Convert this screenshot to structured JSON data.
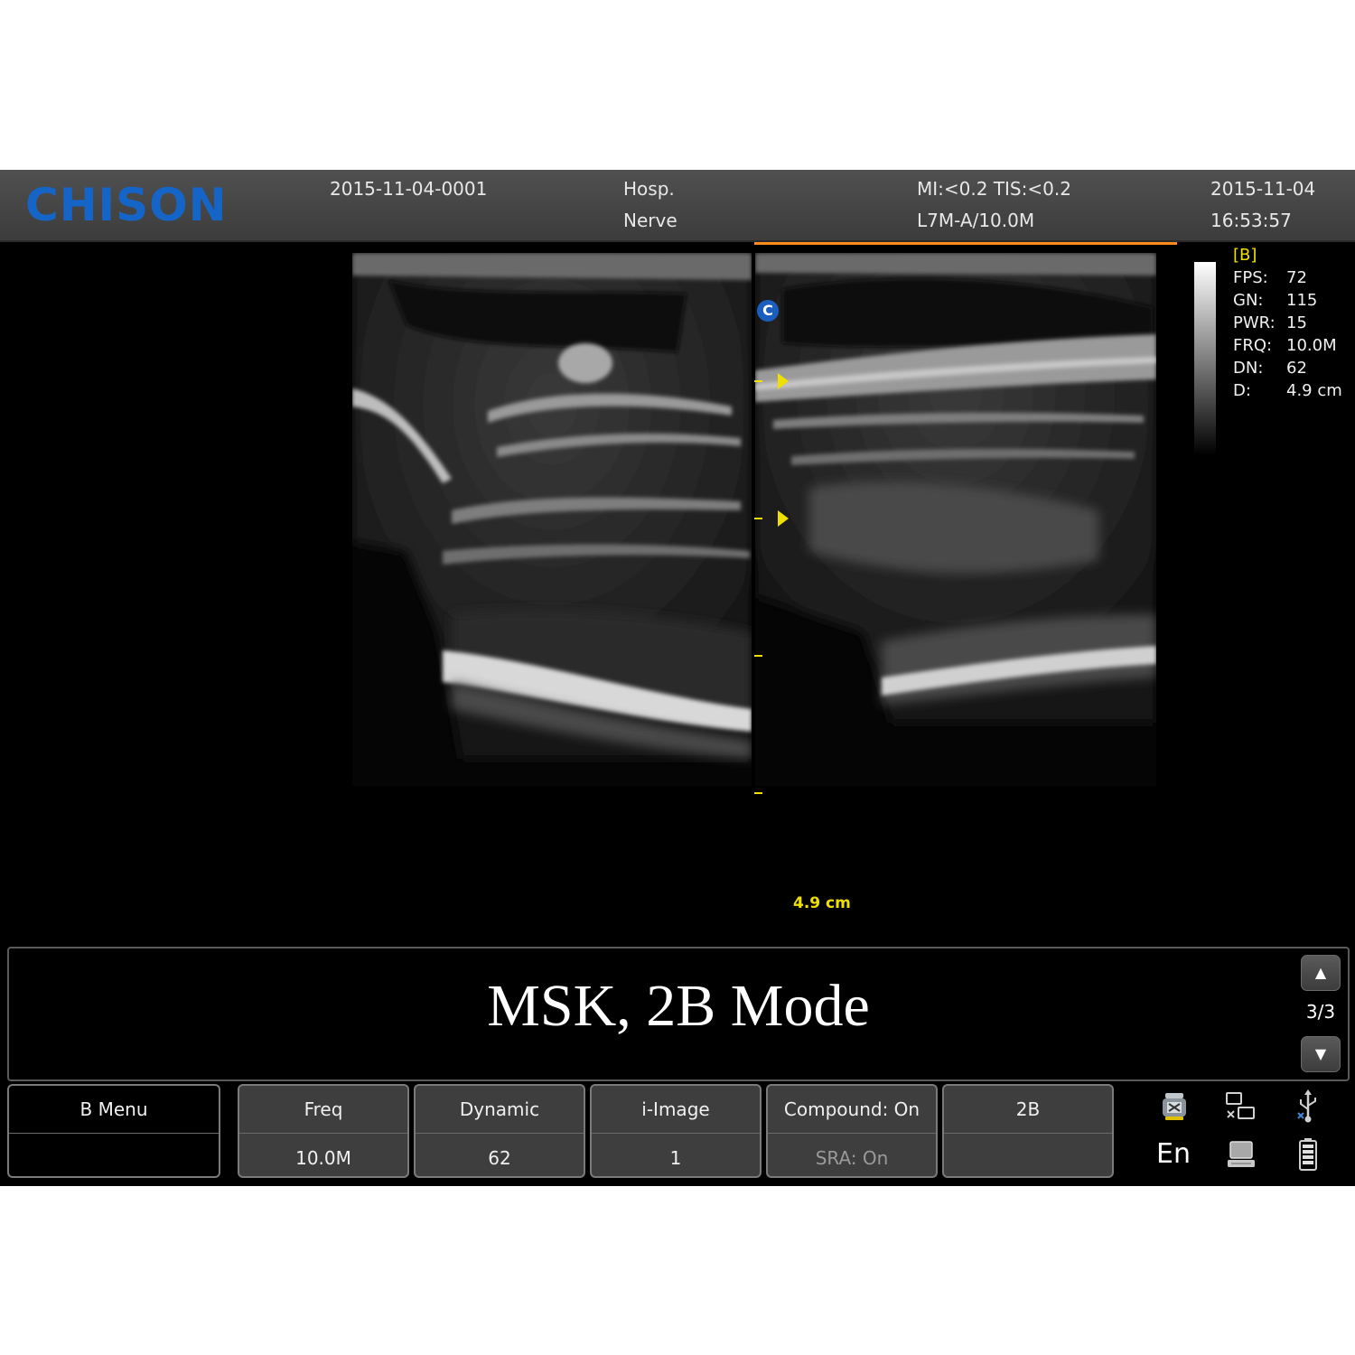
{
  "header": {
    "brand": "CHISON",
    "exam_id": "2015-11-04-0001",
    "hospital": "Hosp.",
    "preset": "Nerve",
    "mi_tis": "MI:<0.2  TIS:<0.2",
    "probe": "L7M-A/10.0M",
    "date": "2015-11-04",
    "time": "16:53:57"
  },
  "image": {
    "mode_tag": "[B]",
    "center_marker": "C",
    "depth_label": "4.9 cm",
    "params": [
      {
        "key": "FPS:",
        "value": "72"
      },
      {
        "key": "GN:",
        "value": "115"
      },
      {
        "key": "PWR:",
        "value": "15"
      },
      {
        "key": "FRQ:",
        "value": "10.0M"
      },
      {
        "key": "DN:",
        "value": "62"
      },
      {
        "key": "D:",
        "value": "4.9 cm"
      }
    ]
  },
  "caption": {
    "text": "MSK, 2B Mode",
    "page": "3/3"
  },
  "softkeys": [
    {
      "top": "B Menu",
      "bottom": ""
    },
    {
      "top": "Freq",
      "bottom": "10.0M"
    },
    {
      "top": "Dynamic",
      "bottom": "62"
    },
    {
      "top": "i-Image",
      "bottom": "1"
    },
    {
      "top": "Compound: On",
      "bottom": "SRA: On"
    },
    {
      "top": "2B",
      "bottom": ""
    }
  ],
  "status": {
    "language": "En",
    "icons": [
      "print-disabled-icon",
      "network-disconnected-icon",
      "usb-icon",
      "computer-icon",
      "battery-icon"
    ]
  },
  "colors": {
    "brand": "#1565c8",
    "annotation": "#f0e000",
    "active_line": "#ff8c1a"
  }
}
